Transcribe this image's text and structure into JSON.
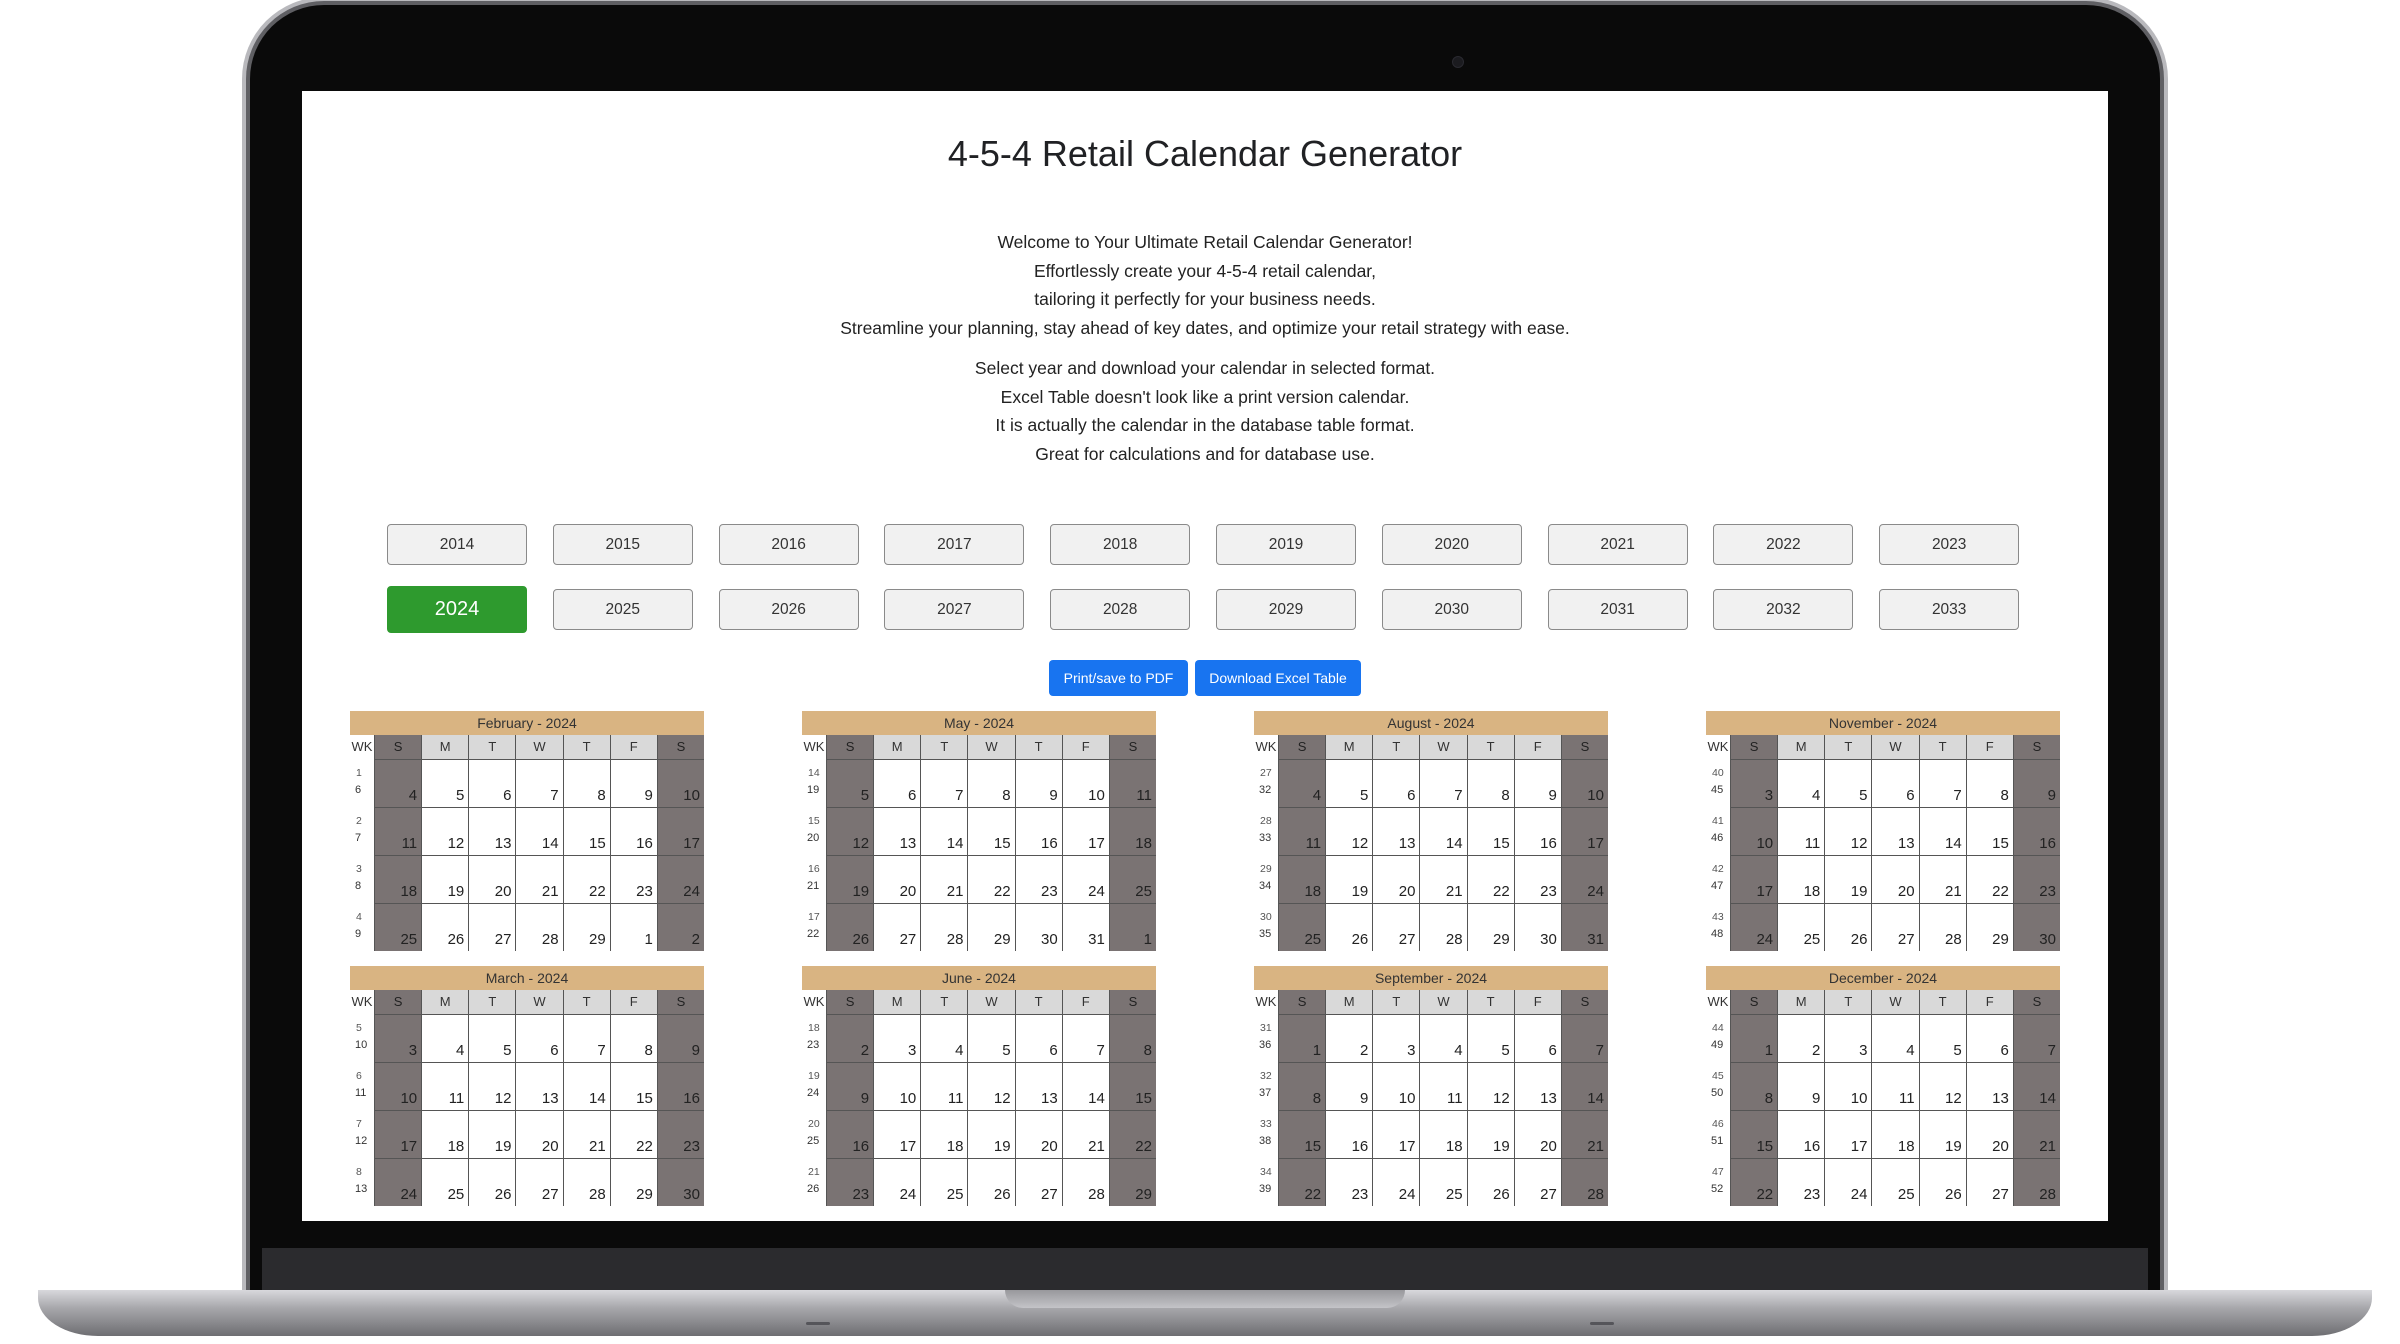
{
  "page": {
    "title": "4-5-4 Retail Calendar Generator",
    "intro": [
      "Welcome to Your Ultimate Retail Calendar Generator!",
      "Effortlessly create your 4-5-4 retail calendar,",
      "tailoring it perfectly for your business needs.",
      "Streamline your planning, stay ahead of key dates, and optimize your retail strategy with ease."
    ],
    "instructions": [
      "Select year and download your calendar in selected format.",
      "Excel Table doesn't look like a print version calendar.",
      "It is actually the calendar in the database table format.",
      "Great for calculations and for database use."
    ],
    "selected_year": "2024",
    "years": [
      "2014",
      "2015",
      "2016",
      "2017",
      "2018",
      "2019",
      "2020",
      "2021",
      "2022",
      "2023",
      "2024",
      "2025",
      "2026",
      "2027",
      "2028",
      "2029",
      "2030",
      "2031",
      "2032",
      "2033"
    ],
    "buttons": {
      "pdf": "Print/save to PDF",
      "excel": "Download Excel Table"
    },
    "colors": {
      "selected_year": "#2e9a2e",
      "action_button": "#1874f0",
      "month_header": "#d9b482",
      "weekend": "#7a7373"
    }
  },
  "calendar": {
    "wk_label": "WK",
    "day_headers": [
      "S",
      "M",
      "T",
      "W",
      "T",
      "F",
      "S"
    ],
    "months": [
      {
        "title": "February - 2024",
        "weeks": [
          {
            "a": "1",
            "b": "6",
            "days": [
              "",
              "4",
              "5",
              "6",
              "7",
              "8",
              "9",
              "10"
            ]
          },
          {
            "a": "2",
            "b": "7",
            "days": [
              "",
              "11",
              "12",
              "13",
              "14",
              "15",
              "16",
              "17"
            ]
          },
          {
            "a": "3",
            "b": "8",
            "days": [
              "",
              "18",
              "19",
              "20",
              "21",
              "22",
              "23",
              "24"
            ]
          },
          {
            "a": "4",
            "b": "9",
            "days": [
              "",
              "25",
              "26",
              "27",
              "28",
              "29",
              "1",
              "2"
            ]
          }
        ]
      },
      {
        "title": "May - 2024",
        "weeks": [
          {
            "a": "14",
            "b": "19",
            "days": [
              "",
              "5",
              "6",
              "7",
              "8",
              "9",
              "10",
              "11"
            ]
          },
          {
            "a": "15",
            "b": "20",
            "days": [
              "",
              "12",
              "13",
              "14",
              "15",
              "16",
              "17",
              "18"
            ]
          },
          {
            "a": "16",
            "b": "21",
            "days": [
              "",
              "19",
              "20",
              "21",
              "22",
              "23",
              "24",
              "25"
            ]
          },
          {
            "a": "17",
            "b": "22",
            "days": [
              "",
              "26",
              "27",
              "28",
              "29",
              "30",
              "31",
              "1"
            ]
          }
        ]
      },
      {
        "title": "August - 2024",
        "weeks": [
          {
            "a": "27",
            "b": "32",
            "days": [
              "",
              "4",
              "5",
              "6",
              "7",
              "8",
              "9",
              "10"
            ]
          },
          {
            "a": "28",
            "b": "33",
            "days": [
              "",
              "11",
              "12",
              "13",
              "14",
              "15",
              "16",
              "17"
            ]
          },
          {
            "a": "29",
            "b": "34",
            "days": [
              "",
              "18",
              "19",
              "20",
              "21",
              "22",
              "23",
              "24"
            ]
          },
          {
            "a": "30",
            "b": "35",
            "days": [
              "",
              "25",
              "26",
              "27",
              "28",
              "29",
              "30",
              "31"
            ]
          }
        ]
      },
      {
        "title": "November - 2024",
        "weeks": [
          {
            "a": "40",
            "b": "45",
            "days": [
              "",
              "3",
              "4",
              "5",
              "6",
              "7",
              "8",
              "9"
            ]
          },
          {
            "a": "41",
            "b": "46",
            "days": [
              "",
              "10",
              "11",
              "12",
              "13",
              "14",
              "15",
              "16"
            ]
          },
          {
            "a": "42",
            "b": "47",
            "days": [
              "",
              "17",
              "18",
              "19",
              "20",
              "21",
              "22",
              "23"
            ]
          },
          {
            "a": "43",
            "b": "48",
            "days": [
              "",
              "24",
              "25",
              "26",
              "27",
              "28",
              "29",
              "30"
            ]
          }
        ]
      },
      {
        "title": "March - 2024",
        "weeks": [
          {
            "a": "5",
            "b": "10",
            "days": [
              "",
              "3",
              "4",
              "5",
              "6",
              "7",
              "8",
              "9"
            ]
          },
          {
            "a": "6",
            "b": "11",
            "days": [
              "",
              "10",
              "11",
              "12",
              "13",
              "14",
              "15",
              "16"
            ]
          },
          {
            "a": "7",
            "b": "12",
            "days": [
              "",
              "17",
              "18",
              "19",
              "20",
              "21",
              "22",
              "23"
            ]
          },
          {
            "a": "8",
            "b": "13",
            "days": [
              "",
              "24",
              "25",
              "26",
              "27",
              "28",
              "29",
              "30"
            ]
          }
        ]
      },
      {
        "title": "June - 2024",
        "weeks": [
          {
            "a": "18",
            "b": "23",
            "days": [
              "",
              "2",
              "3",
              "4",
              "5",
              "6",
              "7",
              "8"
            ]
          },
          {
            "a": "19",
            "b": "24",
            "days": [
              "",
              "9",
              "10",
              "11",
              "12",
              "13",
              "14",
              "15"
            ]
          },
          {
            "a": "20",
            "b": "25",
            "days": [
              "",
              "16",
              "17",
              "18",
              "19",
              "20",
              "21",
              "22"
            ]
          },
          {
            "a": "21",
            "b": "26",
            "days": [
              "",
              "23",
              "24",
              "25",
              "26",
              "27",
              "28",
              "29"
            ]
          }
        ]
      },
      {
        "title": "September - 2024",
        "weeks": [
          {
            "a": "31",
            "b": "36",
            "days": [
              "",
              "1",
              "2",
              "3",
              "4",
              "5",
              "6",
              "7"
            ]
          },
          {
            "a": "32",
            "b": "37",
            "days": [
              "",
              "8",
              "9",
              "10",
              "11",
              "12",
              "13",
              "14"
            ]
          },
          {
            "a": "33",
            "b": "38",
            "days": [
              "",
              "15",
              "16",
              "17",
              "18",
              "19",
              "20",
              "21"
            ]
          },
          {
            "a": "34",
            "b": "39",
            "days": [
              "",
              "22",
              "23",
              "24",
              "25",
              "26",
              "27",
              "28"
            ]
          }
        ]
      },
      {
        "title": "December - 2024",
        "weeks": [
          {
            "a": "44",
            "b": "49",
            "days": [
              "",
              "1",
              "2",
              "3",
              "4",
              "5",
              "6",
              "7"
            ]
          },
          {
            "a": "45",
            "b": "50",
            "days": [
              "",
              "8",
              "9",
              "10",
              "11",
              "12",
              "13",
              "14"
            ]
          },
          {
            "a": "46",
            "b": "51",
            "days": [
              "",
              "15",
              "16",
              "17",
              "18",
              "19",
              "20",
              "21"
            ]
          },
          {
            "a": "47",
            "b": "52",
            "days": [
              "",
              "22",
              "23",
              "24",
              "25",
              "26",
              "27",
              "28"
            ]
          }
        ]
      }
    ]
  }
}
